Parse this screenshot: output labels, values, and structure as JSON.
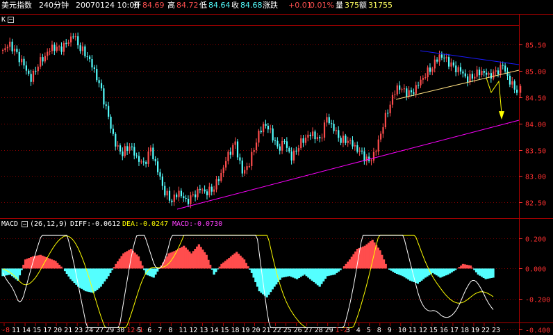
{
  "header": {
    "name": "美元指数",
    "period": "240分钟",
    "datetime": "20070124 10:00",
    "open_label": "开",
    "open": "84.69",
    "high_label": "高",
    "high": "84.72",
    "low_label": "低",
    "low": "84.64",
    "close_label": "收",
    "close": "84.68",
    "change_label": "涨跌",
    "change": "+0.01",
    "change_pct": "0.01%",
    "volume_label": "量",
    "volume": "375",
    "amount_label": "额",
    "amount": "31755"
  },
  "kline_panel": {
    "label": "K",
    "close_button_glyph": "⊟"
  },
  "macd_panel": {
    "title": "MACD",
    "params": "(26,12,9)",
    "diff_label": "DIFF:",
    "diff": "-0.0612",
    "dea_label": "DEA:",
    "dea": "-0.0247",
    "macd_label": "MACD:",
    "macd": "-0.0730"
  },
  "colors": {
    "up": "#ff4d4d",
    "down": "#54ffff",
    "grid": "#8c0000",
    "axis_text": "#ff3030",
    "diff_line": "#ffffff",
    "dea_line": "#ffff00",
    "macd_text": "#ff40ff",
    "trend_lower": "#ff00ff",
    "trend_upper": "#1a1aff",
    "wedge_lower": "#ffe080",
    "arrow": "#ffff00"
  },
  "chart_data": [
    {
      "type": "candlestick",
      "title": "美元指数 240分钟",
      "ylim": [
        82.25,
        85.85
      ],
      "yticks": [
        "85.50",
        "85.00",
        "84.50",
        "84.00",
        "83.50",
        "83.00",
        "82.50"
      ],
      "yticks_values": [
        85.5,
        85.0,
        84.5,
        84.0,
        83.5,
        83.0,
        82.5
      ],
      "closes_approx": [
        85.4,
        85.5,
        85.3,
        85.1,
        84.85,
        85.15,
        85.3,
        85.45,
        85.4,
        85.5,
        85.7,
        85.45,
        85.3,
        85.0,
        84.6,
        84.1,
        83.6,
        83.45,
        83.6,
        83.35,
        83.2,
        83.5,
        83.1,
        82.7,
        82.55,
        82.7,
        82.5,
        82.6,
        82.75,
        82.7,
        82.8,
        83.05,
        83.4,
        83.6,
        83.05,
        83.25,
        83.7,
        84.0,
        83.85,
        83.5,
        83.65,
        83.35,
        83.6,
        83.75,
        83.8,
        83.65,
        84.1,
        83.9,
        83.7,
        83.7,
        83.55,
        83.4,
        83.25,
        83.5,
        84.0,
        84.4,
        84.7,
        84.6,
        84.55,
        84.75,
        84.95,
        85.1,
        85.3,
        85.2,
        85.05,
        85.0,
        84.85,
        84.95,
        85.0,
        84.9,
        84.95,
        85.1,
        84.8,
        84.65
      ],
      "overlays": [
        {
          "name": "lower support trendline",
          "color": "trend_lower"
        },
        {
          "name": "upper wedge trendline",
          "color": "trend_upper"
        },
        {
          "name": "lower wedge trendline",
          "color": "wedge_lower"
        },
        {
          "name": "projection arrow",
          "color": "arrow"
        }
      ]
    },
    {
      "type": "bar+line",
      "title": "MACD (26,12,9)",
      "ylim": [
        -0.42,
        0.24
      ],
      "yticks": [
        "0.200",
        "0.000",
        "-0.200",
        "-0.400"
      ],
      "yticks_values": [
        0.2,
        0.0,
        -0.2,
        -0.4
      ],
      "macd_hist_approx": [
        -0.05,
        -0.04,
        -0.08,
        0.06,
        0.08,
        0.09,
        0.07,
        0.05,
        0.0,
        -0.07,
        -0.12,
        -0.15,
        -0.16,
        -0.12,
        -0.05,
        0.03,
        0.1,
        0.13,
        0.08,
        -0.04,
        -0.06,
        0.02,
        0.1,
        0.12,
        0.15,
        0.1,
        0.16,
        0.09,
        -0.04,
        0.03,
        0.07,
        0.11,
        0.06,
        -0.03,
        -0.15,
        -0.19,
        -0.12,
        -0.06,
        -0.05,
        -0.07,
        -0.04,
        -0.08,
        -0.12,
        -0.05,
        -0.04,
        0.0,
        0.06,
        0.13,
        0.15,
        0.19,
        0.12,
        0.0,
        -0.03,
        -0.05,
        -0.08,
        -0.1,
        -0.06,
        -0.03,
        -0.06,
        -0.04,
        -0.01,
        0.03,
        0.02,
        -0.04,
        -0.07,
        -0.06
      ]
    }
  ],
  "x_axis": {
    "labels": [
      {
        "text": "-8",
        "color": "red"
      },
      {
        "text": "11",
        "color": "white"
      },
      {
        "text": "14",
        "color": "white"
      },
      {
        "text": "15",
        "color": "white"
      },
      {
        "text": "17",
        "color": "white"
      },
      {
        "text": "20",
        "color": "white"
      },
      {
        "text": "21",
        "color": "white"
      },
      {
        "text": "23",
        "color": "white"
      },
      {
        "text": "24",
        "color": "white"
      },
      {
        "text": "27",
        "color": "white"
      },
      {
        "text": "29",
        "color": "white"
      },
      {
        "text": "30",
        "color": "white"
      },
      {
        "text": "12-1",
        "color": "red"
      },
      {
        "text": "5",
        "color": "white"
      },
      {
        "text": "6",
        "color": "white"
      },
      {
        "text": "7",
        "color": "white"
      },
      {
        "text": "8",
        "color": "white"
      },
      {
        "text": "11",
        "color": "white"
      },
      {
        "text": "12",
        "color": "white"
      },
      {
        "text": "13",
        "color": "white"
      },
      {
        "text": "14",
        "color": "white"
      },
      {
        "text": "15",
        "color": "white"
      },
      {
        "text": "18",
        "color": "white"
      },
      {
        "text": "19",
        "color": "white"
      },
      {
        "text": "20",
        "color": "white"
      },
      {
        "text": "21",
        "color": "white"
      },
      {
        "text": "22",
        "color": "white"
      },
      {
        "text": "25",
        "color": "white"
      },
      {
        "text": "26",
        "color": "white"
      },
      {
        "text": "27",
        "color": "white"
      },
      {
        "text": "28",
        "color": "white"
      },
      {
        "text": "29",
        "color": "white"
      },
      {
        "text": "1-2",
        "color": "red"
      },
      {
        "text": "3",
        "color": "white"
      },
      {
        "text": "4",
        "color": "white"
      },
      {
        "text": "5",
        "color": "white"
      },
      {
        "text": "8",
        "color": "white"
      },
      {
        "text": "9",
        "color": "white"
      },
      {
        "text": "10",
        "color": "white"
      },
      {
        "text": "11",
        "color": "white"
      },
      {
        "text": "12",
        "color": "white"
      },
      {
        "text": "15",
        "color": "white"
      },
      {
        "text": "16",
        "color": "white"
      },
      {
        "text": "17",
        "color": "white"
      },
      {
        "text": "18",
        "color": "white"
      },
      {
        "text": "19",
        "color": "white"
      },
      {
        "text": "22",
        "color": "white"
      },
      {
        "text": "23",
        "color": "white"
      }
    ]
  }
}
